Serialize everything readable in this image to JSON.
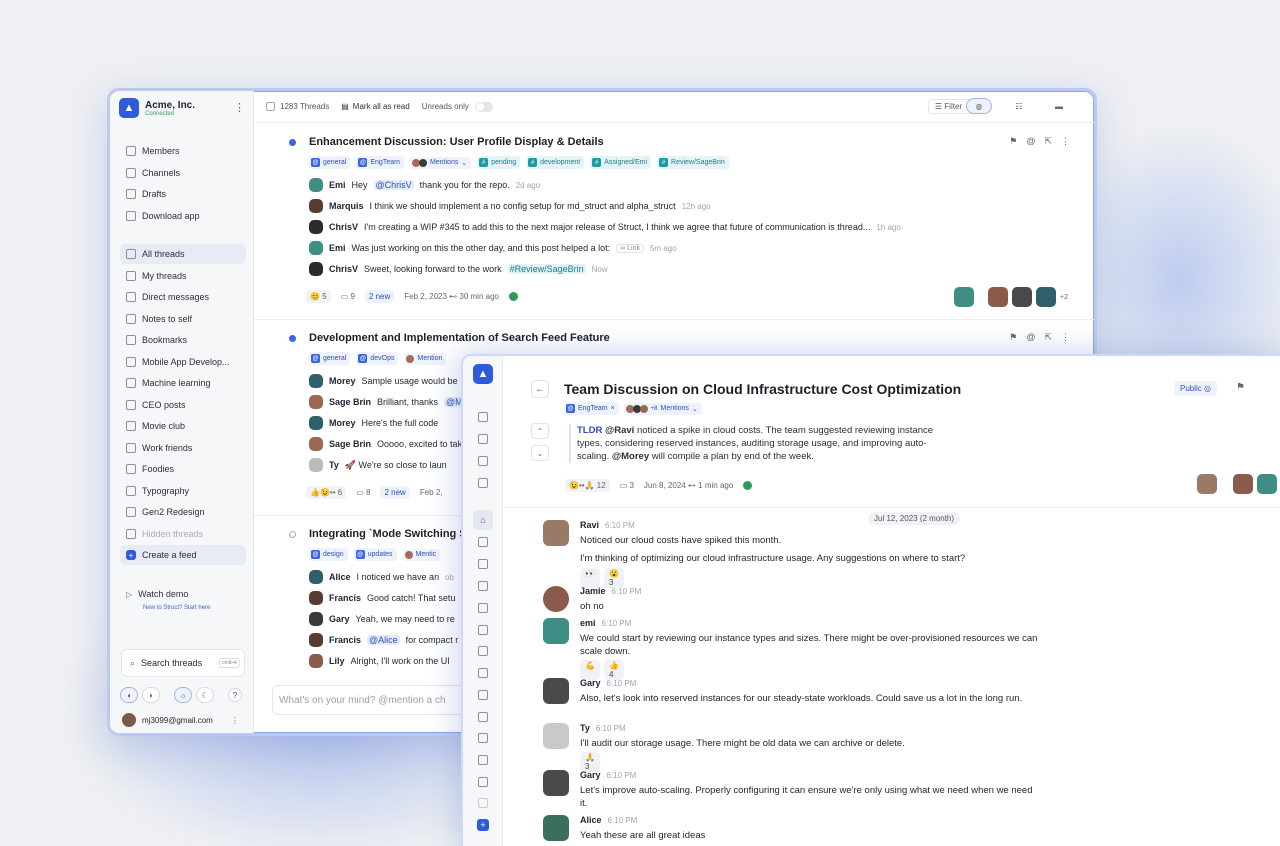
{
  "org": {
    "name": "Acme, Inc.",
    "status": "Connected"
  },
  "sidebar": {
    "top_items": [
      {
        "label": "Members",
        "icon": "members-icon"
      },
      {
        "label": "Channels",
        "icon": "channels-icon"
      },
      {
        "label": "Drafts",
        "icon": "drafts-icon"
      },
      {
        "label": "Download app",
        "icon": "download-icon"
      }
    ],
    "feeds": [
      {
        "label": "All threads",
        "active": true
      },
      {
        "label": "My threads"
      },
      {
        "label": "Direct messages"
      },
      {
        "label": "Notes to self"
      },
      {
        "label": "Bookmarks"
      },
      {
        "label": "Mobile App Develop..."
      },
      {
        "label": "Machine learning"
      },
      {
        "label": "CEO posts"
      },
      {
        "label": "Movie club"
      },
      {
        "label": "Work friends"
      },
      {
        "label": "Foodies"
      },
      {
        "label": "Typography"
      },
      {
        "label": "Gen2 Redesign"
      },
      {
        "label": "Hidden threads",
        "muted": true
      },
      {
        "label": "Create a feed"
      }
    ],
    "watch_demo": "Watch demo",
    "watch_sub": "New to Struct? Start here",
    "search_label": "Search threads",
    "search_kbd": "cmd+k",
    "user_email": "mj3099@gmail.com"
  },
  "toolbar": {
    "thread_count": "1283 Threads",
    "mark_read": "Mark all as read",
    "unreads_only": "Unreads only",
    "filter": "Filter"
  },
  "threads": [
    {
      "title": "Enhancement Discussion: User Profile Display & Details",
      "tags": [
        "general",
        "EngTeam",
        "Mentions",
        "pending",
        "development",
        "Assigned/Emi",
        "Review/SageBrin"
      ],
      "messages": [
        {
          "who": "Emi",
          "pre": "Hey",
          "mention": "@ChrisV",
          "post": "thank you for the repo.",
          "time": "2d ago"
        },
        {
          "who": "Marquis",
          "pre": "I think we should implement a no config setup for md_struct and alpha_struct",
          "time": "12h ago"
        },
        {
          "who": "ChrisV",
          "pre": "I'm creating a WIP #345 to add this to the next major release of Struct, I think we agree that future of communication is thread...",
          "time": "1h ago"
        },
        {
          "who": "Emi",
          "pre": "Was just working on this the other day, and this post helped a lot:",
          "link": "Link",
          "time": "5m ago"
        },
        {
          "who": "ChrisV",
          "pre": "Sweet, looking forward to the work",
          "hashtag": "#Review/SageBrin",
          "time": "Now"
        }
      ],
      "foot": {
        "reacts": "5",
        "replies": "9",
        "new": "2 new",
        "date": "Feb 2, 2023 ⊷ 30 min ago",
        "more": "+2"
      }
    },
    {
      "title": "Development and Implementation of Search Feed Feature",
      "tags": [
        "general",
        "devOps",
        "Mention"
      ],
      "messages": [
        {
          "who": "Morey",
          "pre": "Sample usage would be"
        },
        {
          "who": "Sage Brin",
          "pre": "Brilliant, thanks",
          "mention": "@M"
        },
        {
          "who": "Morey",
          "pre": "Here's the full code"
        },
        {
          "who": "Sage Brin",
          "pre": "Ooooo, excited to tak"
        },
        {
          "who": "Ty",
          "pre": "🚀 We're so close to laun"
        }
      ],
      "foot": {
        "reacts": "6",
        "replies": "8",
        "new": "2 new",
        "date": "Feb 2,"
      }
    },
    {
      "title": "Integrating `Mode Switching S",
      "tags": [
        "design",
        "updates",
        "Mentic"
      ],
      "messages": [
        {
          "who": "Alice",
          "pre": "I noticed we have an",
          "tail": "ob"
        },
        {
          "who": "Francis",
          "pre": "Good catch! That setu"
        },
        {
          "who": "Gary",
          "pre": "Yeah, we may need to re"
        },
        {
          "who": "Francis",
          "mention": "@Alice",
          "post": "for compact r"
        },
        {
          "who": "Lily",
          "pre": "Alright, I'll work on the UI"
        }
      ]
    }
  ],
  "composer_placeholder": "What's on your mind? @mention a ch",
  "detail": {
    "title": "Team Discussion on Cloud Infrastructure Cost Optimization",
    "visibility": "Public",
    "tags": [
      "EngTeam",
      "+8",
      "Mentions"
    ],
    "tldr_label": "TLDR",
    "tldr_mention": "@Ravi",
    "tldr_text": "noticed a spike in cloud costs. The team suggested reviewing instance types, considering reserved instances, auditing storage usage, and improving auto-scaling.",
    "tldr_mention2": "@Morey",
    "tldr_text2": "will compile a plan by end of the week.",
    "foot": {
      "reacts": "12",
      "replies": "3",
      "date": "Jun 8, 2024 ⊷ 1 min ago"
    },
    "date_chip": "Jul 12, 2023 (2 month)",
    "messages": [
      {
        "who": "Ravi",
        "time": "6:10 PM",
        "text": "Noticed our cloud costs have spiked this month.",
        "text2": "I'm thinking of optimizing our cloud infrastructure usage. Any suggestions on where to start?",
        "reacts": [
          "👀",
          "😮 3"
        ]
      },
      {
        "who": "Jamie",
        "time": "6:10 PM",
        "text": "oh no"
      },
      {
        "who": "emi",
        "time": "6:10 PM",
        "text": "We could start by reviewing our instance types and sizes. There might be over-provisioned resources we can scale down.",
        "reacts": [
          "💪",
          "👍 4"
        ]
      },
      {
        "who": "Gary",
        "time": "6:10 PM",
        "text": "Also, let's look into reserved instances for our steady-state workloads. Could save us a lot in the long run."
      },
      {
        "who": "Ty",
        "time": "6:10 PM",
        "text": "I'll audit our storage usage. There might be old data we can archive or delete.",
        "reacts": [
          "🙏 3"
        ]
      },
      {
        "who": "Gary",
        "time": "6:10 PM",
        "text": "Let's improve auto-scaling. Properly configuring it can ensure we're only using what we need when we need it."
      },
      {
        "who": "Alice",
        "time": "6:10 PM",
        "text": "Yeah these are all great ideas"
      }
    ]
  },
  "colors": {
    "brand": "#2f5bdb",
    "success": "#2e9b5b",
    "hashtag": "#1c9aa8"
  }
}
